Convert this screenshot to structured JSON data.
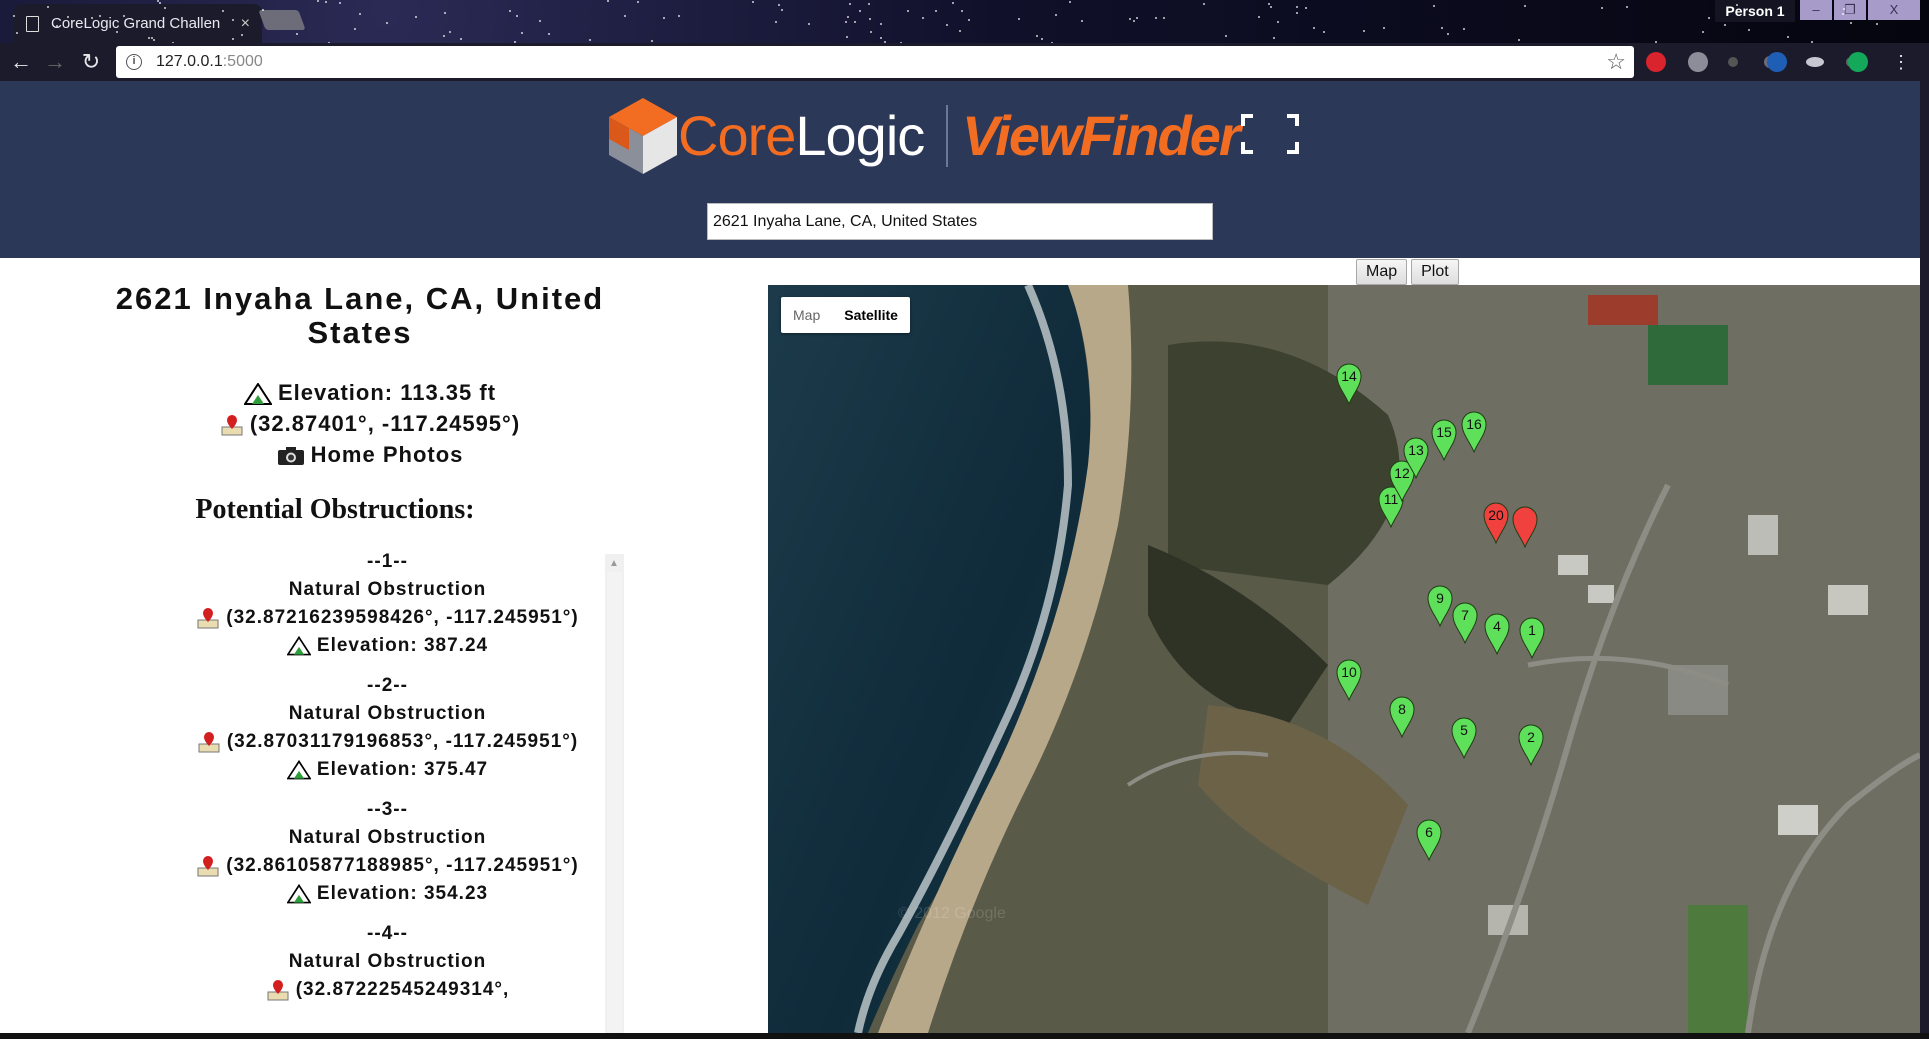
{
  "browser": {
    "tab_title": "CoreLogic Grand Challen",
    "tab_close": "×",
    "profile_name": "Person 1",
    "url_host": "127.0.0.1",
    "url_port": ":5000",
    "window_min": "–",
    "window_restore": "❐",
    "window_close": "X"
  },
  "header": {
    "brand_core": "Core",
    "brand_logic": "Logic",
    "brand_product": "ViewFinder",
    "search_value": "2621 Inyaha Lane, CA, United States",
    "colors": {
      "bg": "#2b3858",
      "accent": "#f26d22"
    }
  },
  "view_toggle": {
    "map_label": "Map",
    "plot_label": "Plot"
  },
  "property": {
    "address": "2621 Inyaha Lane, CA, United States",
    "elevation": "Elevation: 113.35 ft",
    "coords": "(32.87401°, -117.24595°)",
    "photos_link": "Home Photos"
  },
  "obstructions": {
    "heading": "Potential Obstructions:",
    "items": [
      {
        "index": "--1--",
        "type": "Natural Obstruction",
        "coords": "(32.87216239598426°, -117.245951°)",
        "elevation": "Elevation: 387.24"
      },
      {
        "index": "--2--",
        "type": "Natural Obstruction",
        "coords": "(32.87031179196853°, -117.245951°)",
        "elevation": "Elevation: 375.47"
      },
      {
        "index": "--3--",
        "type": "Natural Obstruction",
        "coords": "(32.86105877188985°, -117.245951°)",
        "elevation": "Elevation: 354.23"
      },
      {
        "index": "--4--",
        "type": "Natural Obstruction",
        "coords": "(32.87222545249314°,",
        "elevation": ""
      }
    ]
  },
  "map": {
    "type_map_label": "Map",
    "type_satellite_label": "Satellite",
    "active_type": "Satellite",
    "watermark": "© 2012 Google",
    "markers_green": [
      "1",
      "2",
      "4",
      "5",
      "6",
      "7",
      "8",
      "9",
      "10",
      "11",
      "12",
      "13",
      "14",
      "15",
      "16"
    ],
    "markers_red": [
      "20",
      ""
    ]
  }
}
